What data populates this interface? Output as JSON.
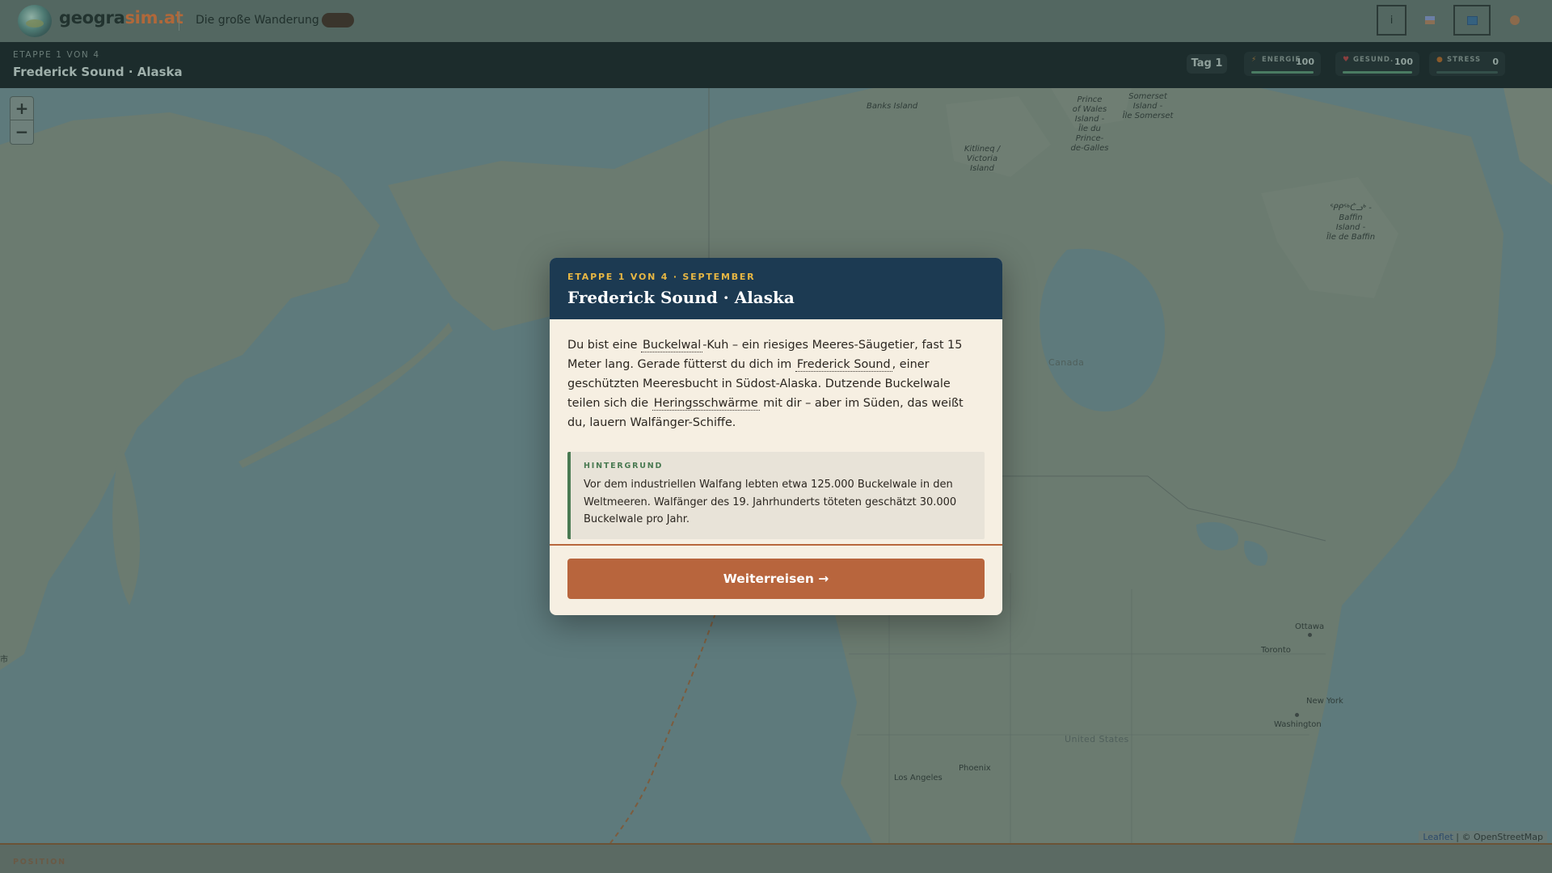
{
  "header": {
    "brand_main": "geogra",
    "brand_accent": "sim.at",
    "subtitle": "Die große Wanderung",
    "beta_badge": "",
    "info_label": "i"
  },
  "stagebar": {
    "kicker": "ETAPPE 1 VON 4",
    "title": "Frederick Sound · Alaska",
    "day_label": "Tag 1",
    "stats": [
      {
        "label": "ENERGIE",
        "value": "100",
        "level": 1.0,
        "icon_color": "#8a6a3a"
      },
      {
        "label": "GESUND.",
        "value": "100",
        "level": 1.0,
        "icon_color": "#8a3f3f"
      },
      {
        "label": "STRESS",
        "value": "0",
        "level": 0.0,
        "icon_color": "#8a5a2a"
      }
    ]
  },
  "map": {
    "zoom_in": "+",
    "zoom_out": "−",
    "places": {
      "banks": "Banks Island",
      "prince1": "Prince",
      "prince2": "of Wales",
      "prince3": "Island -",
      "prince4": "Île du Prince-",
      "prince5": "de-Galles",
      "somerset1": "Somerset",
      "somerset2": "Island -",
      "somerset3": "Île Somerset",
      "victoria1": "Kitlineq /",
      "victoria2": "Victoria",
      "victoria3": "Island",
      "baffin1": "ᕿᑭᖅᑖᓗᒃ -",
      "baffin2": "Baffin",
      "baffin3": "Island -",
      "baffin4": "Île de Baffin",
      "canada": "Canada",
      "united_states": "United States",
      "ottawa": "Ottawa",
      "toronto": "Toronto",
      "new_york": "New York",
      "washington": "Washington",
      "phoenix": "Phoenix",
      "los_angeles": "Los Angeles",
      "edge_char": "市"
    },
    "attribution_leaflet": "Leaflet",
    "attribution_rest": " | © OpenStreetMap"
  },
  "bottom": {
    "label": "POSITION"
  },
  "modal": {
    "kicker": "ETAPPE 1 VON 4 · SEPTEMBER",
    "title": "Frederick Sound · Alaska",
    "story": {
      "t1": "Du bist eine ",
      "term1": "Buckelwal",
      "t2": "-Kuh – ein riesiges Meeres-Säugetier, fast 15 Meter lang. Gerade fütterst du dich im ",
      "term2": "Frederick Sound",
      "t3": ", einer geschützten Meeresbucht in Südost-Alaska. Dutzende Buckelwale teilen sich die ",
      "term3": "Heringsschwärme",
      "t4": " mit dir – aber im Süden, das weißt du, lauern Walfänger-Schiffe."
    },
    "background_label": "HINTERGRUND",
    "background_text": "Vor dem industriellen Walfang lebten etwa 125.000 Buckelwale in den Weltmeeren. Walfänger des 19. Jahrhunderts töteten geschätzt 30.000 Buckelwale pro Jahr.",
    "cta_label": "Weiterreisen →"
  },
  "colors": {
    "modal_header": "#1c3a52",
    "kicker_gold": "#e8b743",
    "cta": "#b8653d",
    "background_accent": "#4a7a52"
  }
}
